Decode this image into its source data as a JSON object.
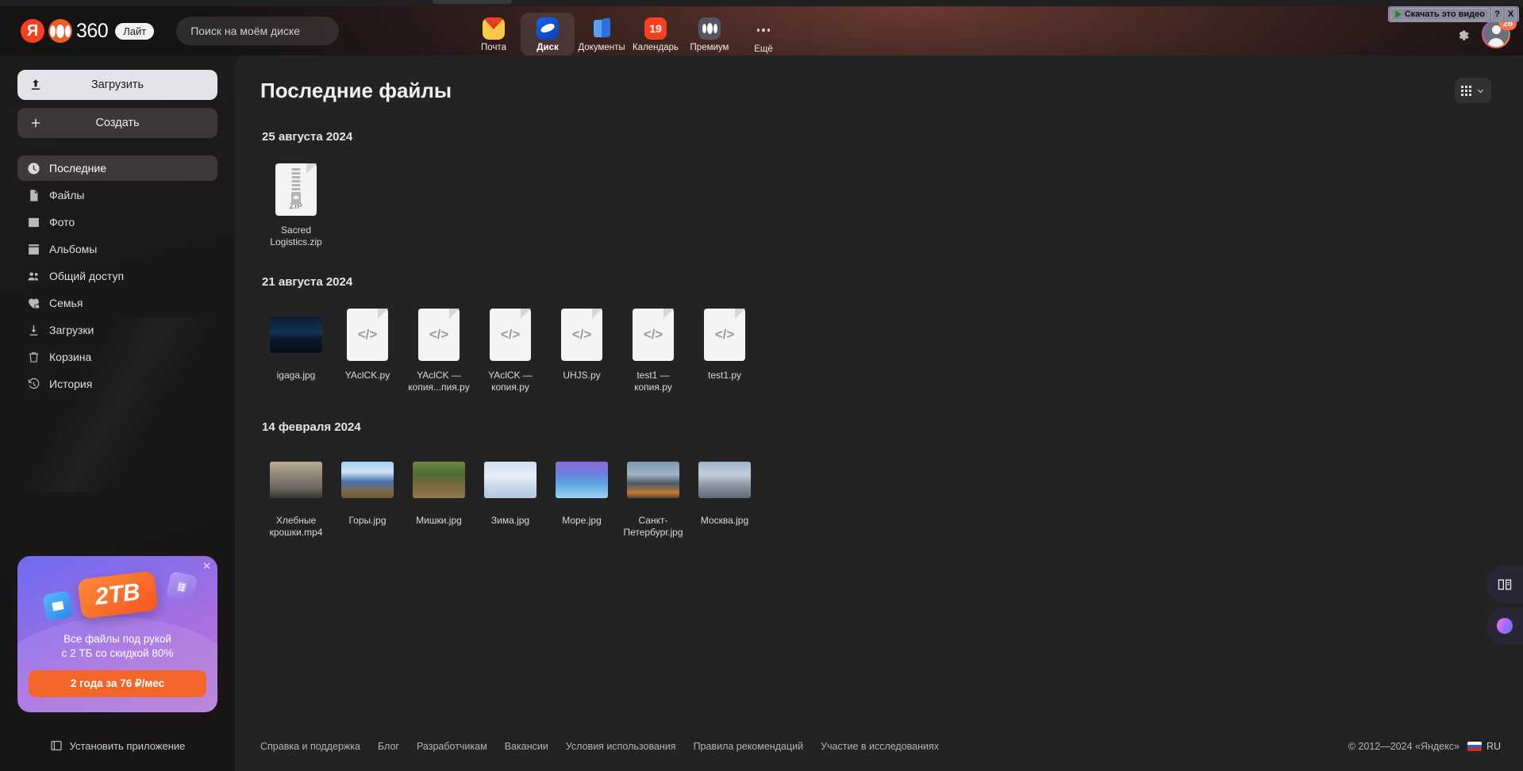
{
  "browser": {
    "extension_overlay": {
      "download_label": "Скачать это видео",
      "help_label": "?",
      "close_label": "X"
    }
  },
  "header": {
    "logo": {
      "ya": "Я",
      "brand": "360",
      "plan_badge": "Лайт"
    },
    "search": {
      "placeholder": "Поиск на моём диске",
      "value": "",
      "icon": "search-icon"
    },
    "nav": [
      {
        "label": "Почта",
        "icon": "mail-icon",
        "active": false,
        "badge": ""
      },
      {
        "label": "Диск",
        "icon": "disk-icon",
        "active": true,
        "badge": ""
      },
      {
        "label": "Документы",
        "icon": "documents-icon",
        "active": false,
        "badge": ""
      },
      {
        "label": "Календарь",
        "icon": "calendar-icon",
        "active": false,
        "badge": "19"
      },
      {
        "label": "Премиум",
        "icon": "premium-icon",
        "active": false,
        "badge": ""
      },
      {
        "label": "Ещё",
        "icon": "more-icon",
        "active": false,
        "badge": ""
      }
    ],
    "settings_icon": "gear-icon",
    "avatar_badge": "26"
  },
  "sidebar": {
    "upload_label": "Загрузить",
    "create_label": "Создать",
    "items": [
      {
        "label": "Последние",
        "icon": "clock-icon",
        "active": true
      },
      {
        "label": "Файлы",
        "icon": "file-icon",
        "active": false
      },
      {
        "label": "Фото",
        "icon": "photo-icon",
        "active": false
      },
      {
        "label": "Альбомы",
        "icon": "albums-icon",
        "active": false
      },
      {
        "label": "Общий доступ",
        "icon": "people-icon",
        "active": false
      },
      {
        "label": "Семья",
        "icon": "heart-lock-icon",
        "active": false
      },
      {
        "label": "Загрузки",
        "icon": "download-icon",
        "active": false
      },
      {
        "label": "Корзина",
        "icon": "trash-icon",
        "active": false
      },
      {
        "label": "История",
        "icon": "history-icon",
        "active": false
      }
    ],
    "promo": {
      "badge": "2ТВ",
      "line1": "Все файлы под рукой",
      "line2": "с 2 ТБ со скидкой 80%",
      "cta": "2 года за 76 ₽/мес",
      "close_icon": "close-icon"
    },
    "install_app_label": "Установить приложение"
  },
  "main": {
    "title": "Последние файлы",
    "view_toggle": {
      "icon": "grid-view-icon",
      "chevron": "chevron-down-icon"
    },
    "groups": [
      {
        "date": "25 августа 2024",
        "files": [
          {
            "name": "Sacred Logistics.zip",
            "kind": "zip",
            "badge": "ZIP"
          }
        ]
      },
      {
        "date": "21 августа 2024",
        "files": [
          {
            "name": "igaga.jpg",
            "kind": "photo",
            "theme": "night-lake"
          },
          {
            "name": "YAclCK.py",
            "kind": "code",
            "badge": "</>"
          },
          {
            "name": "YAclCK — копия...пия.py",
            "kind": "code",
            "badge": "</>"
          },
          {
            "name": "YAclCK — копия.py",
            "kind": "code",
            "badge": "</>"
          },
          {
            "name": "UHJS.py",
            "kind": "code",
            "badge": "</>"
          },
          {
            "name": "test1 — копия.py",
            "kind": "code",
            "badge": "</>"
          },
          {
            "name": "test1.py",
            "kind": "code",
            "badge": "</>"
          }
        ]
      },
      {
        "date": "14 февраля 2024",
        "files": [
          {
            "name": "Хлебные крошки.mp4",
            "kind": "photo",
            "theme": "street"
          },
          {
            "name": "Горы.jpg",
            "kind": "photo",
            "theme": "mountains"
          },
          {
            "name": "Мишки.jpg",
            "kind": "photo",
            "theme": "bears"
          },
          {
            "name": "Зима.jpg",
            "kind": "photo",
            "theme": "winter"
          },
          {
            "name": "Море.jpg",
            "kind": "photo",
            "theme": "sea"
          },
          {
            "name": "Санкт-Петербург.jpg",
            "kind": "photo",
            "theme": "spb"
          },
          {
            "name": "Москва.jpg",
            "kind": "photo",
            "theme": "moscow"
          }
        ]
      }
    ]
  },
  "footer": {
    "links": [
      "Справка и поддержка",
      "Блог",
      "Разработчикам",
      "Вакансии",
      "Условия использования",
      "Правила рекомендаций",
      "Участие в исследованиях"
    ],
    "copyright": "© 2012—2024 «Яндекс»",
    "lang": "RU"
  },
  "colors": {
    "accent_red": "#fc3f1d",
    "accent_orange": "#f4652a",
    "panel": "#232323",
    "sidebar": "#1a1818"
  }
}
